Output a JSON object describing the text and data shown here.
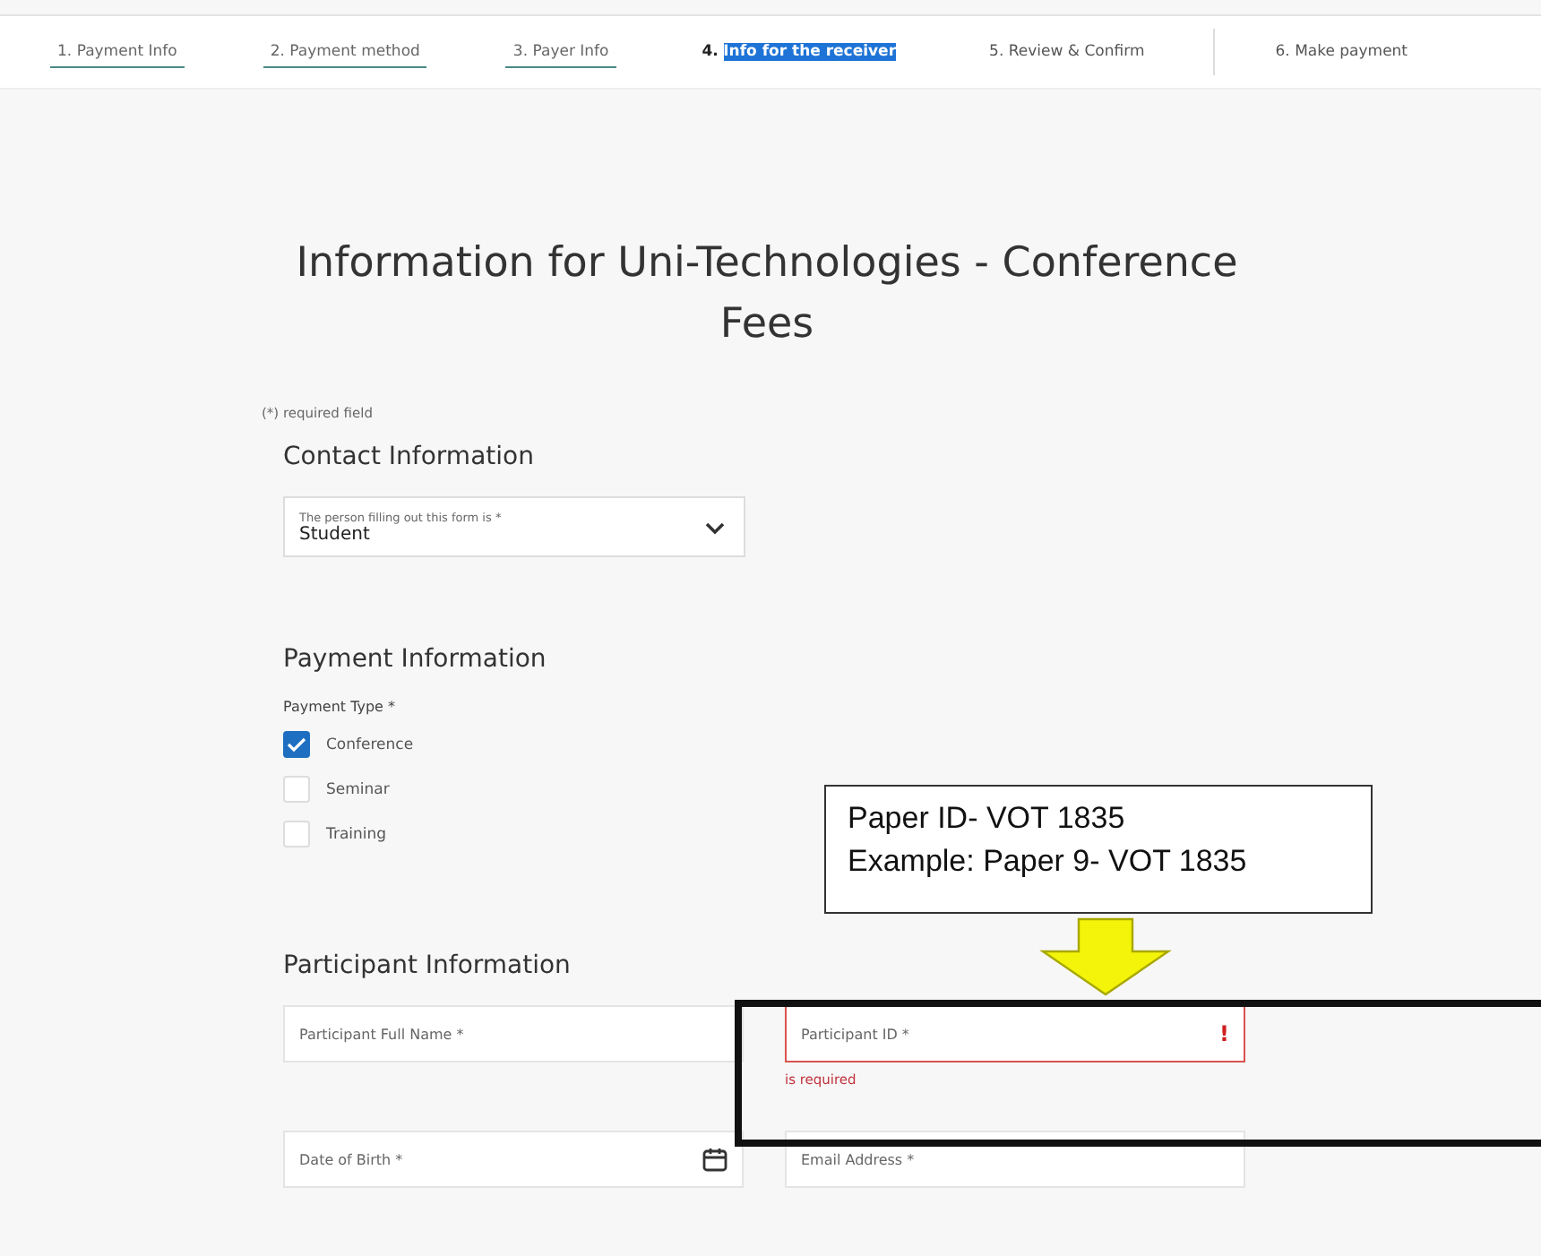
{
  "steps": [
    {
      "number": "1.",
      "label": "Payment Info",
      "done": true,
      "selected": false
    },
    {
      "number": "2.",
      "label": "Payment method",
      "done": true,
      "selected": false
    },
    {
      "number": "3.",
      "label": "Payer Info",
      "done": true,
      "selected": false
    },
    {
      "number": "4.",
      "label": "Info for the receiver",
      "done": false,
      "selected": true
    },
    {
      "number": "5.",
      "label": "Review & Confirm",
      "done": false,
      "selected": false
    },
    {
      "number": "6.",
      "label": "Make payment",
      "done": false,
      "selected": false
    }
  ],
  "title": "Information for Uni-Technologies - Conference Fees",
  "required_note": "(*) required field",
  "contact": {
    "heading": "Contact Information",
    "select": {
      "label": "The person filling out this form is *",
      "value": "Student"
    }
  },
  "payment": {
    "heading": "Payment Information",
    "group_label": "Payment Type *",
    "options": [
      {
        "label": "Conference",
        "checked": true
      },
      {
        "label": "Seminar",
        "checked": false
      },
      {
        "label": "Training",
        "checked": false
      }
    ]
  },
  "participant": {
    "heading": "Participant Information",
    "fields": [
      {
        "kind": "text",
        "placeholder": "Participant Full Name *",
        "error": false
      },
      {
        "kind": "text",
        "placeholder": "Participant ID *",
        "error": true,
        "error_text": "is required",
        "error_icon": "!"
      },
      {
        "kind": "date",
        "placeholder": "Date of Birth *",
        "error": false
      },
      {
        "kind": "text",
        "placeholder": "Email Address *",
        "error": false
      }
    ]
  },
  "annotation": {
    "lines": [
      "Paper ID- VOT 1835",
      "Example: Paper 9- VOT 1835"
    ]
  }
}
